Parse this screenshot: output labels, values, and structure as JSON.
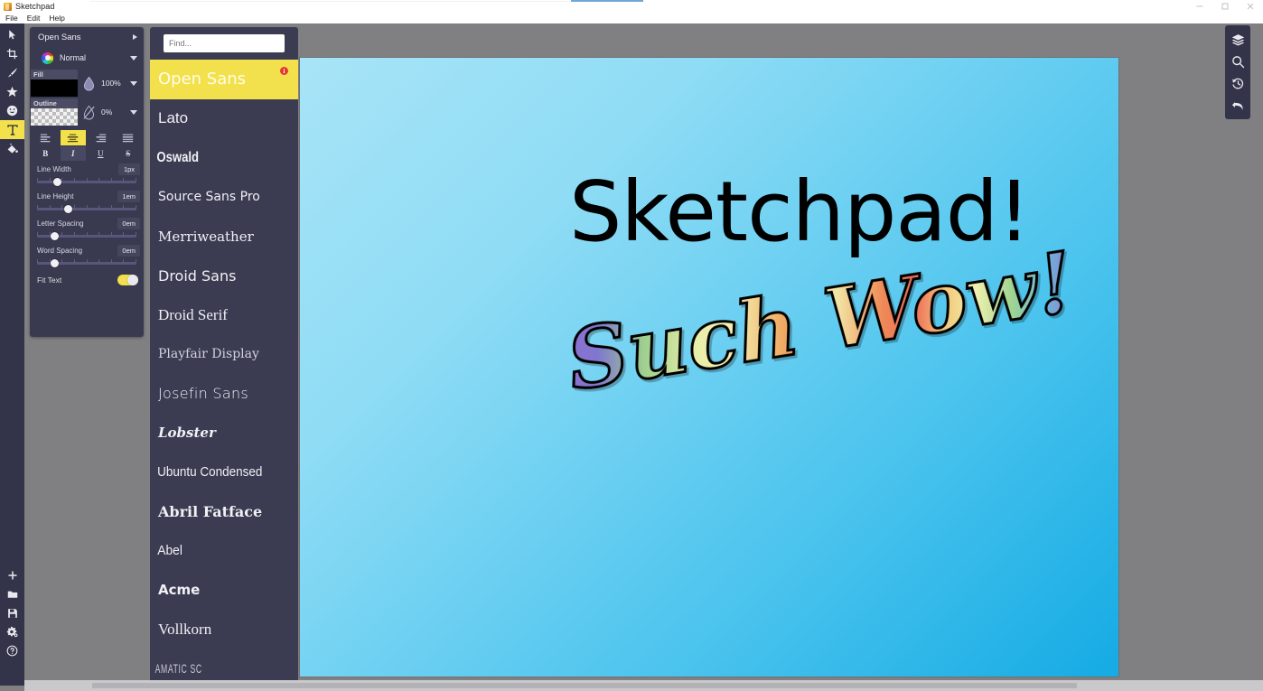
{
  "window": {
    "title": "Sketchpad",
    "app_icon": "sketchpad-logo-icon",
    "minimize": "–",
    "maximize": "❐",
    "close": "✕"
  },
  "menubar": {
    "items": [
      {
        "label": "File"
      },
      {
        "label": "Edit"
      },
      {
        "label": "Help"
      }
    ]
  },
  "left_toolbar": {
    "tools": [
      {
        "name": "select-tool",
        "icon": "cursor-arrow-icon",
        "active": false
      },
      {
        "name": "crop-tool",
        "icon": "crop-icon",
        "active": false
      },
      {
        "name": "draw-tool",
        "icon": "pen-brush-icon",
        "active": false
      },
      {
        "name": "shape-tool",
        "icon": "star-icon",
        "active": false
      },
      {
        "name": "sticker-tool",
        "icon": "smiley-face-icon",
        "active": false
      },
      {
        "name": "text-tool",
        "icon": "text-t-icon",
        "active": true
      },
      {
        "name": "fill-tool",
        "icon": "paint-bucket-icon",
        "active": false
      }
    ],
    "bottom_tools": [
      {
        "name": "new-button",
        "icon": "plus-icon"
      },
      {
        "name": "open-button",
        "icon": "folder-icon"
      },
      {
        "name": "save-button",
        "icon": "floppy-disk-icon"
      },
      {
        "name": "settings-button",
        "icon": "gears-icon"
      },
      {
        "name": "help-button",
        "icon": "question-circle-icon"
      }
    ]
  },
  "right_toolbar": {
    "tools": [
      {
        "name": "layers-button",
        "icon": "layers-stack-icon"
      },
      {
        "name": "zoom-button",
        "icon": "magnifier-icon"
      },
      {
        "name": "history-button",
        "icon": "clock-history-icon"
      },
      {
        "name": "undo-button",
        "icon": "undo-arrow-icon"
      }
    ]
  },
  "text_panel": {
    "font_name": "Open Sans",
    "font_expand_icon": "chevron-right-icon",
    "blend_mode": "Normal",
    "blend_mode_icon": "color-wheel-icon",
    "blend_caret": "chevron-down-icon",
    "fill": {
      "label": "Fill",
      "color": "#000000",
      "opacity": "100%",
      "opacity_icon": "droplet-icon"
    },
    "outline": {
      "label": "Outline",
      "color": "transparent",
      "opacity": "0%",
      "opacity_icon": "droplet-slash-icon"
    },
    "align_buttons": [
      {
        "name": "align-left-button",
        "icon": "align-left-icon",
        "active": false
      },
      {
        "name": "align-center-button",
        "icon": "align-center-icon",
        "active": true
      },
      {
        "name": "align-right-button",
        "icon": "align-right-icon",
        "active": false
      },
      {
        "name": "align-justify-button",
        "icon": "align-justify-icon",
        "active": false
      }
    ],
    "style_buttons": [
      {
        "name": "bold-button",
        "label": "B",
        "active": false
      },
      {
        "name": "italic-button",
        "label": "I",
        "active": true
      },
      {
        "name": "underline-button",
        "label": "U",
        "active": false
      },
      {
        "name": "strike-button",
        "label": "S",
        "active": false
      }
    ],
    "sliders": [
      {
        "name": "line-width",
        "label": "Line Width",
        "value": "1px",
        "pos": 16
      },
      {
        "name": "line-height",
        "label": "Line Height",
        "value": "1em",
        "pos": 27
      },
      {
        "name": "letter-spacing",
        "label": "Letter Spacing",
        "value": "0em",
        "pos": 14
      },
      {
        "name": "word-spacing",
        "label": "Word Spacing",
        "value": "0em",
        "pos": 14
      }
    ],
    "fit_text": {
      "label": "Fit Text",
      "enabled": true
    }
  },
  "font_panel": {
    "search_placeholder": "Find...",
    "search_value": "",
    "collapse_icon": "chevron-left-icon",
    "selected": "Open Sans",
    "badge": "i",
    "fonts": [
      {
        "label": "Open Sans",
        "class": "f-opensans",
        "selected": true,
        "badge": true
      },
      {
        "label": "Lato",
        "class": "f-lato",
        "selected": false,
        "badge": false
      },
      {
        "label": "Oswald",
        "class": "f-oswald",
        "selected": false,
        "badge": false
      },
      {
        "label": "Source Sans Pro",
        "class": "f-sourcesans",
        "selected": false,
        "badge": false
      },
      {
        "label": "Merriweather",
        "class": "f-merriweather",
        "selected": false,
        "badge": false
      },
      {
        "label": "Droid Sans",
        "class": "f-droidsans",
        "selected": false,
        "badge": false
      },
      {
        "label": "Droid Serif",
        "class": "f-droidserif",
        "selected": false,
        "badge": false
      },
      {
        "label": "Playfair Display",
        "class": "f-playfair",
        "selected": false,
        "badge": false
      },
      {
        "label": "Josefin Sans",
        "class": "f-josefin",
        "selected": false,
        "badge": false
      },
      {
        "label": "Lobster",
        "class": "f-lobster",
        "selected": false,
        "badge": false
      },
      {
        "label": "Ubuntu Condensed",
        "class": "f-ubuntucond",
        "selected": false,
        "badge": false
      },
      {
        "label": "Abril Fatface",
        "class": "f-abril",
        "selected": false,
        "badge": false
      },
      {
        "label": "Abel",
        "class": "f-abel",
        "selected": false,
        "badge": false
      },
      {
        "label": "Acme",
        "class": "f-acme",
        "selected": false,
        "badge": false
      },
      {
        "label": "Vollkorn",
        "class": "f-vollkorn",
        "selected": false,
        "badge": false
      },
      {
        "label": "AMATIC SC",
        "class": "f-amatic",
        "selected": false,
        "badge": false
      }
    ]
  },
  "canvas": {
    "text_items": [
      {
        "name": "canvas-text-sketchpad",
        "text": "Sketchpad!"
      },
      {
        "name": "canvas-text-such-wow",
        "text": "Such Wow!"
      }
    ]
  },
  "colors": {
    "accent_yellow": "#f2e14c",
    "panel_dark": "#393a50",
    "panel_list": "#3b3c52",
    "toolbar_dark": "#333449",
    "workspace_gray": "#808083",
    "canvas_light": "#a8e4f7",
    "canvas_deep": "#15abe4",
    "badge_red": "#e23b2e"
  }
}
